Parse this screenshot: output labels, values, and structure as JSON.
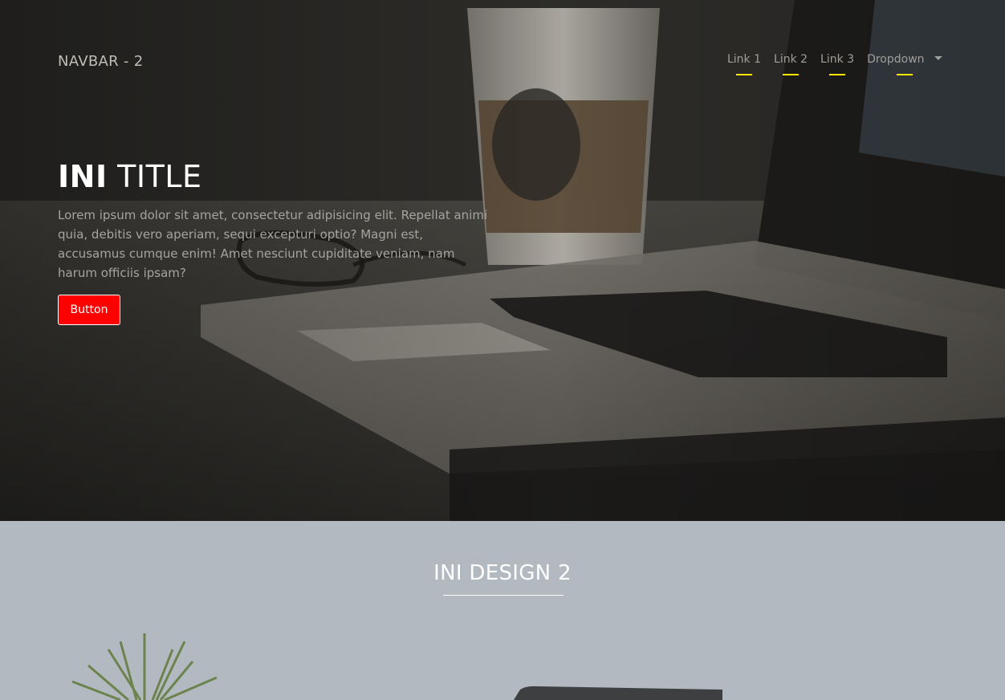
{
  "navbar": {
    "brand": "NAVBAR - 2",
    "links": [
      "Link 1",
      "Link 2",
      "Link 3"
    ],
    "dropdown_label": "Dropdown",
    "underline_color": "#ffe500"
  },
  "hero": {
    "title_bold": "INI",
    "title_rest": " TITLE",
    "text": "Lorem ipsum dolor sit amet, consectetur adipisicing elit. Repellat animi quia, debitis vero aperiam, sequi excepturi optio? Magni est, accusamus cumque enim! Amet nesciunt cupiditate veniam, nam harum officiis ipsam?",
    "button_label": "Button",
    "button_color": "#ff0000"
  },
  "section2": {
    "title": "INI DESIGN 2"
  }
}
